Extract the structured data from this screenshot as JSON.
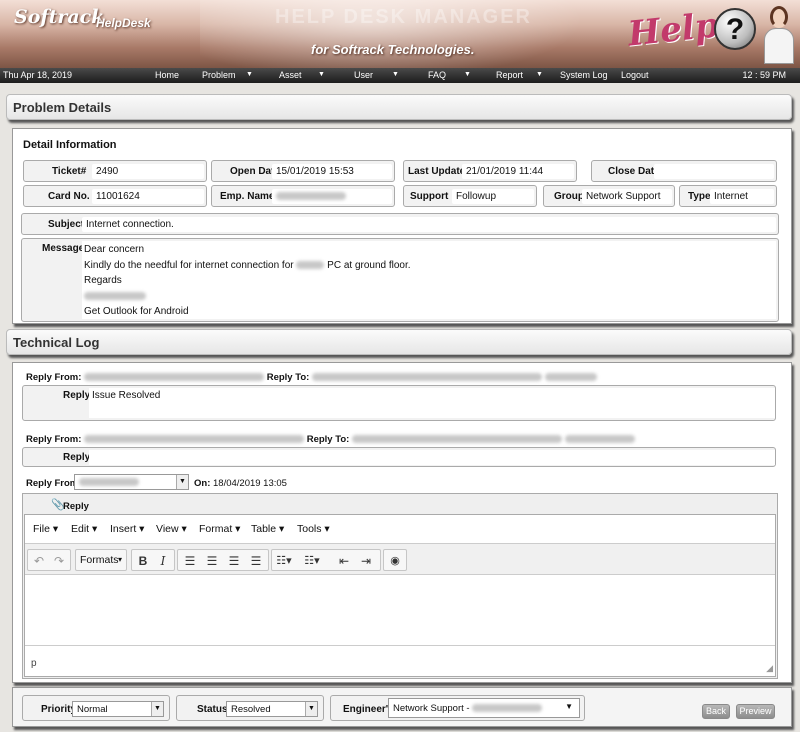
{
  "banner": {
    "logo": "Softrack",
    "logo_sub": "HelpDesk",
    "ghost_title": "HELP DESK MANAGER",
    "tagline": "for Softrack Technologies.",
    "help_word": "Help",
    "help_mark": "?"
  },
  "nav": {
    "date": "Thu Apr 18, 2019",
    "items": [
      "Home",
      "Problem",
      "Asset",
      "User",
      "FAQ",
      "Report",
      "System Log",
      "Logout"
    ],
    "caret": "▼",
    "clock": "12 : 59 PM"
  },
  "problem_details": {
    "section_title": "Problem Details",
    "panel_title": "Detail Information",
    "ticket_label": "Ticket#",
    "ticket_value": "2490",
    "open_date_label": "Open Date",
    "open_date_value": "15/01/2019 15:53",
    "last_updated_label": "Last Updated",
    "last_updated_value": "21/01/2019 11:44",
    "close_date_label": "Close Date",
    "close_date_value": "",
    "card_label": "Card No.",
    "card_value": "11001624",
    "emp_label": "Emp. Name",
    "support_label": "Support",
    "support_value": "Followup",
    "group_label": "Group",
    "group_value": "Network Support",
    "type_label": "Type",
    "type_value": "Internet",
    "subject_label": "Subject",
    "subject_value": "Internet connection.",
    "message_label": "Message",
    "message": {
      "line1": "Dear concern",
      "line2a": "Kindly do the needful for internet connection for",
      "line2b": "PC at ground floor.",
      "line3": "Regards",
      "line5": "Get Outlook for Android"
    }
  },
  "technical_log": {
    "section_title": "Technical Log",
    "entry1": {
      "reply_from_label": "Reply From:",
      "reply_to_label": "Reply To:",
      "reply_label": "Reply",
      "reply_value": "Issue Resolved"
    },
    "entry2": {
      "reply_from_label": "Reply From:",
      "reply_to_label": "Reply To:",
      "reply_label": "Reply",
      "reply_value": ""
    },
    "compose": {
      "reply_from_label": "Reply From:",
      "on_label": "On:",
      "on_value": "18/04/2019 13:05",
      "reply_label": "Reply"
    }
  },
  "editor": {
    "menus": [
      "File",
      "Edit",
      "Insert",
      "View",
      "Format",
      "Table",
      "Tools"
    ],
    "formats_label": "Formats",
    "status_path": "p"
  },
  "footer": {
    "priority_label": "Priority",
    "priority_value": "Normal",
    "status_label": "Status",
    "status_value": "Resolved",
    "engineers_label": "Engineer's",
    "engineers_value": "Network Support -",
    "back_label": "Back",
    "preview_label": "Preview"
  }
}
